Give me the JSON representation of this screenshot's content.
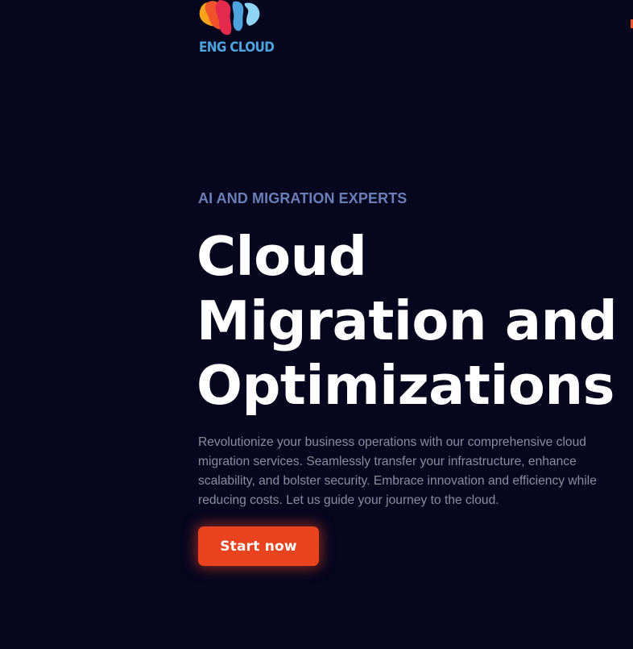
{
  "brand": {
    "name": "ENG CLOUD",
    "logo_icon": "cloud-flame-logo-icon",
    "colors": [
      "#f0532b",
      "#f7a21b",
      "#e42a4c",
      "#4ea3dc",
      "#8fd3f5"
    ]
  },
  "hero": {
    "eyebrow": "AI AND MIGRATION EXPERTS",
    "title_lines": [
      "Cloud",
      "Migration and",
      "Optimizations"
    ],
    "description": "Revolutionize your business operations with our comprehensive cloud migration services. Seamlessly transfer your infrastructure, enhance scalability, and bolster security. Embrace innovation and efficiency while reducing costs. Let us guide your journey to the cloud.",
    "cta_label": "Start now"
  },
  "theme": {
    "background": "#06061f",
    "accent": "#e9431f",
    "eyebrow_color": "#6a7fb6",
    "text_muted": "#8b8d9c"
  }
}
